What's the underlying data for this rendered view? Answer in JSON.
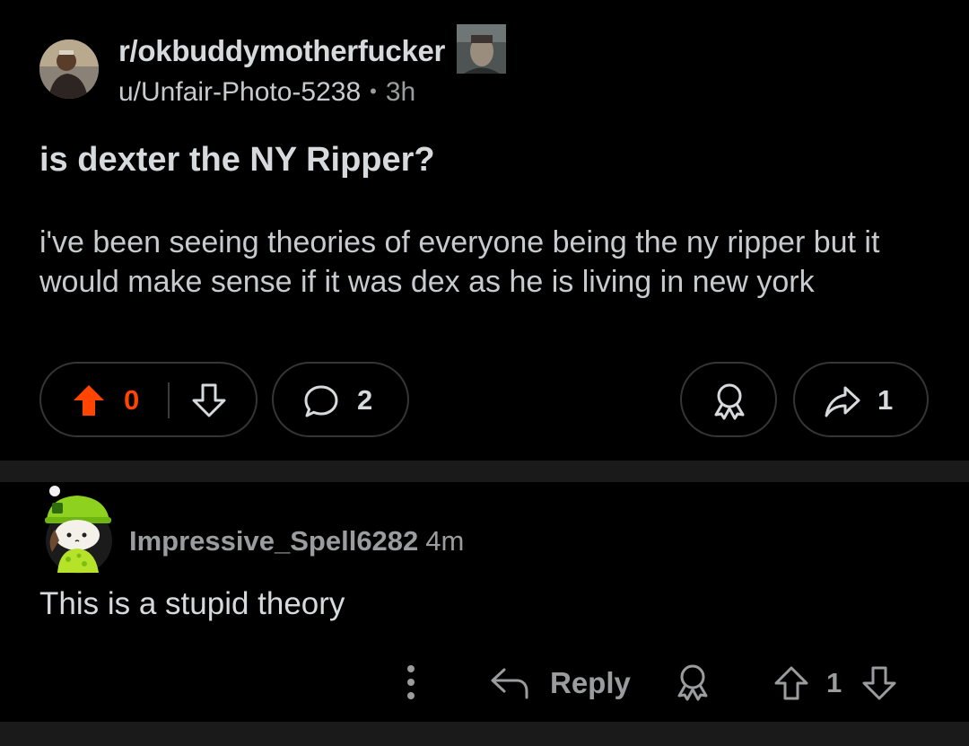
{
  "post": {
    "subreddit": "r/okbuddymotherfucker",
    "author": "u/Unfair-Photo-5238",
    "separator": "•",
    "age": "3h",
    "title": "is dexter the NY Ripper?",
    "body": "i've been seeing theories of everyone being the ny ripper but it would make sense if it was dex as he is living in new york",
    "actions": {
      "vote_count": "0",
      "comment_count": "2",
      "share_count": "1"
    },
    "colors": {
      "upvote_active": "#ff4500",
      "background": "#000000",
      "pill_border": "#343536"
    },
    "icons": [
      "upvote-icon",
      "downvote-icon",
      "comment-icon",
      "award-icon",
      "share-icon"
    ]
  },
  "comment": {
    "author": "Impressive_Spell6282",
    "age": "4m",
    "text": "This is a stupid theory",
    "reply_label": "Reply",
    "vote_count": "1",
    "icons": [
      "more-options-icon",
      "reply-icon",
      "award-icon",
      "upvote-icon",
      "downvote-icon"
    ]
  }
}
